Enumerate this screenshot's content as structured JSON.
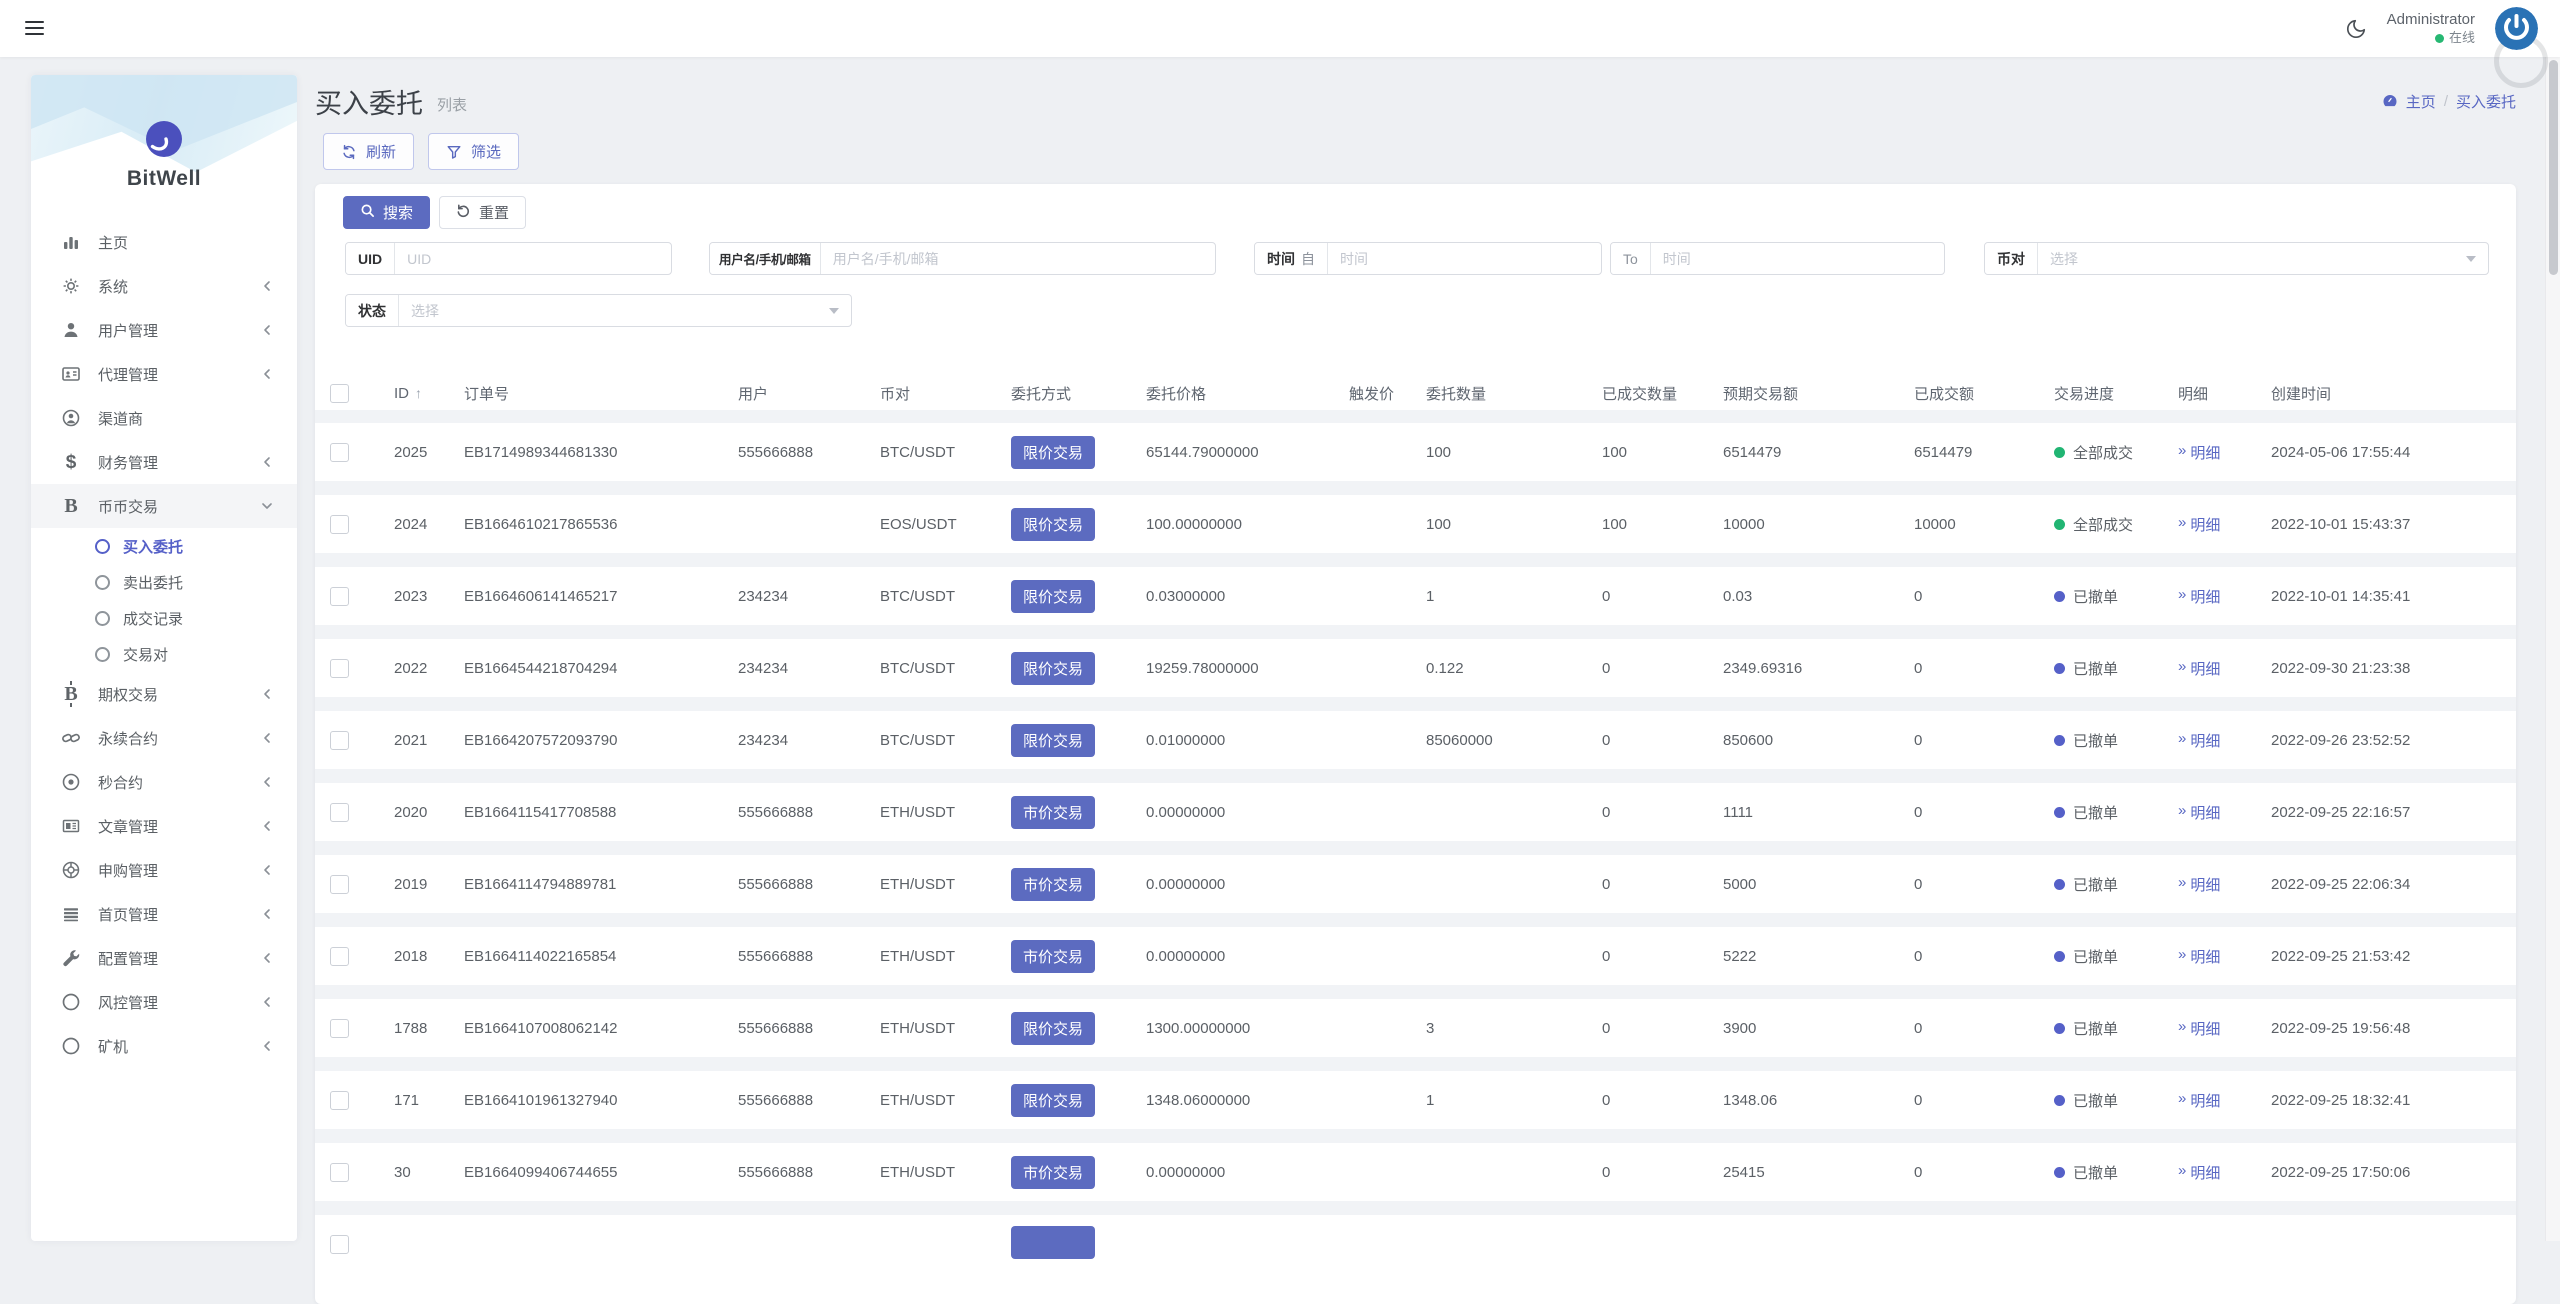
{
  "topbar": {
    "user_name": "Administrator",
    "status_text": "在线"
  },
  "colors": {
    "accent": "#5c6bc0",
    "link": "#5867c3",
    "status_done": "#21b573",
    "status_cancel": "#5560c8",
    "online": "#27b873"
  },
  "sidebar": {
    "brand": "BitWell",
    "items": [
      {
        "key": "home",
        "icon": "bar-chart-icon",
        "label": "主页"
      },
      {
        "key": "system",
        "icon": "gear-icon",
        "label": "系统",
        "chevron": "left"
      },
      {
        "key": "user-management",
        "icon": "user-icon",
        "label": "用户管理",
        "chevron": "left"
      },
      {
        "key": "agent-management",
        "icon": "id-card-icon",
        "label": "代理管理",
        "chevron": "left"
      },
      {
        "key": "channel-provider",
        "icon": "user-circle-icon",
        "label": "渠道商"
      },
      {
        "key": "finance-management",
        "icon": "dollar-icon",
        "label": "财务管理",
        "chevron": "left"
      },
      {
        "key": "spot-trading",
        "icon": "coin-b-icon",
        "label": "币币交易",
        "chevron": "down",
        "expanded": true,
        "submenu": [
          {
            "key": "buy-orders",
            "label": "买入委托",
            "active": true
          },
          {
            "key": "sell-orders",
            "label": "卖出委托"
          },
          {
            "key": "trade-records",
            "label": "成交记录"
          },
          {
            "key": "trading-pairs",
            "label": "交易对"
          }
        ]
      },
      {
        "key": "options-trading",
        "icon": "bitcoin-icon",
        "label": "期权交易",
        "chevron": "left"
      },
      {
        "key": "perpetual-contract",
        "icon": "chain-icon",
        "label": "永续合约",
        "chevron": "left"
      },
      {
        "key": "seconds-contract",
        "icon": "bullseye-icon",
        "label": "秒合约",
        "chevron": "left"
      },
      {
        "key": "article-management",
        "icon": "newspaper-icon",
        "label": "文章管理",
        "chevron": "left"
      },
      {
        "key": "subscription-management",
        "icon": "life-ring-icon",
        "label": "申购管理",
        "chevron": "left"
      },
      {
        "key": "homepage-management",
        "icon": "list-icon",
        "label": "首页管理",
        "chevron": "left"
      },
      {
        "key": "config-management",
        "icon": "wrench-icon",
        "label": "配置管理",
        "chevron": "left"
      },
      {
        "key": "risk-management",
        "icon": "circle-icon",
        "label": "风控管理",
        "chevron": "left"
      },
      {
        "key": "miner",
        "icon": "circle-icon",
        "label": "矿机",
        "chevron": "left"
      }
    ]
  },
  "page": {
    "title": "买入委托",
    "subtitle": "列表",
    "breadcrumb": [
      "主页",
      "买入委托"
    ],
    "toolbar": {
      "refresh": "刷新",
      "filter": "筛选"
    }
  },
  "filters": {
    "search_label": "搜索",
    "reset_label": "重置",
    "uid": {
      "label": "UID",
      "placeholder": "UID"
    },
    "user": {
      "label": "用户名/手机/邮箱",
      "placeholder": "用户名/手机/邮箱"
    },
    "time": {
      "label": "时间",
      "from_label": "自",
      "to_label": "To",
      "placeholder": "时间"
    },
    "pair": {
      "label": "币对",
      "placeholder": "选择"
    },
    "status": {
      "label": "状态",
      "placeholder": "选择"
    }
  },
  "table": {
    "sort_indicator": "↑",
    "columns": [
      "ID",
      "订单号",
      "用户",
      "币对",
      "委托方式",
      "委托价格",
      "触发价",
      "委托数量",
      "已成交数量",
      "预期交易额",
      "已成交额",
      "交易进度",
      "明细",
      "创建时间"
    ],
    "rows": [
      {
        "id": "2025",
        "order": "EB1714989344681330",
        "user": "555666888",
        "pair": "BTC/USDT",
        "type": "限价交易",
        "price": "65144.79000000",
        "trigger": "",
        "qty": "100",
        "filled_qty": "100",
        "expected": "6514479",
        "filled_amt": "6514479",
        "status": "全部成交",
        "status_key": "done",
        "detail": "明细",
        "created": "2024-05-06 17:55:44"
      },
      {
        "id": "2024",
        "order": "EB1664610217865536",
        "user": "",
        "pair": "EOS/USDT",
        "type": "限价交易",
        "price": "100.00000000",
        "trigger": "",
        "qty": "100",
        "filled_qty": "100",
        "expected": "10000",
        "filled_amt": "10000",
        "status": "全部成交",
        "status_key": "done",
        "detail": "明细",
        "created": "2022-10-01 15:43:37"
      },
      {
        "id": "2023",
        "order": "EB1664606141465217",
        "user": "234234",
        "pair": "BTC/USDT",
        "type": "限价交易",
        "price": "0.03000000",
        "trigger": "",
        "qty": "1",
        "filled_qty": "0",
        "expected": "0.03",
        "filled_amt": "0",
        "status": "已撤单",
        "status_key": "cancel",
        "detail": "明细",
        "created": "2022-10-01 14:35:41"
      },
      {
        "id": "2022",
        "order": "EB1664544218704294",
        "user": "234234",
        "pair": "BTC/USDT",
        "type": "限价交易",
        "price": "19259.78000000",
        "trigger": "",
        "qty": "0.122",
        "filled_qty": "0",
        "expected": "2349.69316",
        "filled_amt": "0",
        "status": "已撤单",
        "status_key": "cancel",
        "detail": "明细",
        "created": "2022-09-30 21:23:38"
      },
      {
        "id": "2021",
        "order": "EB1664207572093790",
        "user": "234234",
        "pair": "BTC/USDT",
        "type": "限价交易",
        "price": "0.01000000",
        "trigger": "",
        "qty": "85060000",
        "filled_qty": "0",
        "expected": "850600",
        "filled_amt": "0",
        "status": "已撤单",
        "status_key": "cancel",
        "detail": "明细",
        "created": "2022-09-26 23:52:52"
      },
      {
        "id": "2020",
        "order": "EB1664115417708588",
        "user": "555666888",
        "pair": "ETH/USDT",
        "type": "市价交易",
        "price": "0.00000000",
        "trigger": "",
        "qty": "",
        "filled_qty": "0",
        "expected": "1111",
        "filled_amt": "0",
        "status": "已撤单",
        "status_key": "cancel",
        "detail": "明细",
        "created": "2022-09-25 22:16:57"
      },
      {
        "id": "2019",
        "order": "EB1664114794889781",
        "user": "555666888",
        "pair": "ETH/USDT",
        "type": "市价交易",
        "price": "0.00000000",
        "trigger": "",
        "qty": "",
        "filled_qty": "0",
        "expected": "5000",
        "filled_amt": "0",
        "status": "已撤单",
        "status_key": "cancel",
        "detail": "明细",
        "created": "2022-09-25 22:06:34"
      },
      {
        "id": "2018",
        "order": "EB1664114022165854",
        "user": "555666888",
        "pair": "ETH/USDT",
        "type": "市价交易",
        "price": "0.00000000",
        "trigger": "",
        "qty": "",
        "filled_qty": "0",
        "expected": "5222",
        "filled_amt": "0",
        "status": "已撤单",
        "status_key": "cancel",
        "detail": "明细",
        "created": "2022-09-25 21:53:42"
      },
      {
        "id": "1788",
        "order": "EB1664107008062142",
        "user": "555666888",
        "pair": "ETH/USDT",
        "type": "限价交易",
        "price": "1300.00000000",
        "trigger": "",
        "qty": "3",
        "filled_qty": "0",
        "expected": "3900",
        "filled_amt": "0",
        "status": "已撤单",
        "status_key": "cancel",
        "detail": "明细",
        "created": "2022-09-25 19:56:48"
      },
      {
        "id": "171",
        "order": "EB1664101961327940",
        "user": "555666888",
        "pair": "ETH/USDT",
        "type": "限价交易",
        "price": "1348.06000000",
        "trigger": "",
        "qty": "1",
        "filled_qty": "0",
        "expected": "1348.06",
        "filled_amt": "0",
        "status": "已撤单",
        "status_key": "cancel",
        "detail": "明细",
        "created": "2022-09-25 18:32:41"
      },
      {
        "id": "30",
        "order": "EB1664099406744655",
        "user": "555666888",
        "pair": "ETH/USDT",
        "type": "市价交易",
        "price": "0.00000000",
        "trigger": "",
        "qty": "",
        "filled_qty": "0",
        "expected": "25415",
        "filled_amt": "0",
        "status": "已撤单",
        "status_key": "cancel",
        "detail": "明细",
        "created": "2022-09-25 17:50:06"
      },
      {
        "partial": true,
        "show_badge": true,
        "id": "",
        "order": "",
        "user": "",
        "pair": "",
        "type": "",
        "price": "",
        "trigger": "",
        "qty": "",
        "filled_qty": "",
        "expected": "",
        "filled_amt": "",
        "status": "",
        "status_key": "",
        "detail": "",
        "created": ""
      }
    ]
  }
}
